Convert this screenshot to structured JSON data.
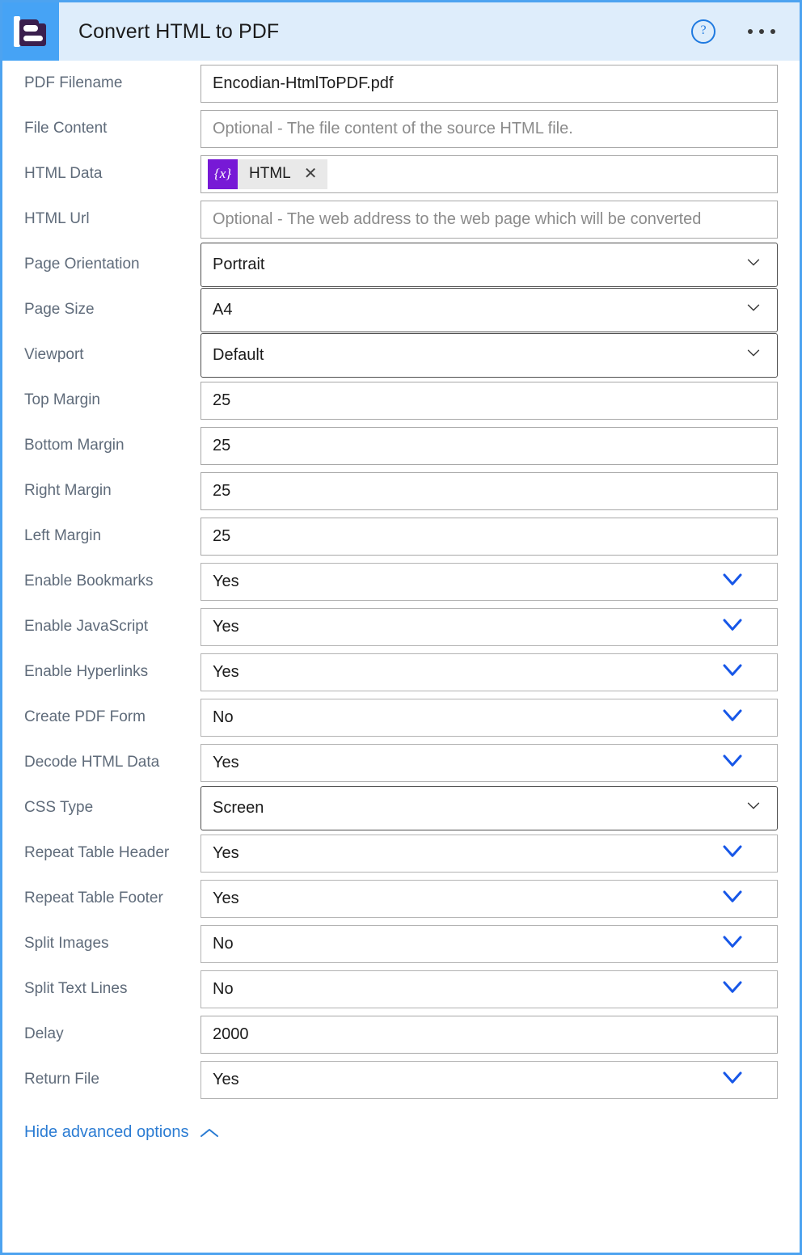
{
  "header": {
    "title": "Convert HTML to PDF",
    "logo_icon": "encodian-e-logo",
    "logo_bg": "#46a3f5",
    "logo_fg": "#3a1f4d",
    "band_bg": "#deedfb",
    "help_icon": "help-question-icon",
    "help_glyph": "?",
    "more_icon": "more-options-ellipsis-icon"
  },
  "theme": {
    "frame_border": "#4da3f0",
    "label_color": "#5f6b7a",
    "link_color": "#2b7cd3",
    "chevron_blue": "#1757e8",
    "chevron_gray": "#3a3a3a",
    "token_badge_bg": "#7719d6",
    "token_bg": "#e9e9e9"
  },
  "fields": [
    {
      "label": "PDF Filename",
      "kind": "text",
      "value": "Encodian-HtmlToPDF.pdf",
      "placeholder": ""
    },
    {
      "label": "File Content",
      "kind": "text",
      "value": "",
      "placeholder": "Optional - The file content of the source HTML file."
    },
    {
      "label": "HTML Data",
      "kind": "token",
      "token_badge": "{x}",
      "token_label": "HTML",
      "token_close": "✕"
    },
    {
      "label": "HTML Url",
      "kind": "text",
      "value": "",
      "placeholder": "Optional - The web address to the web page which will be converted"
    },
    {
      "label": "Page Orientation",
      "kind": "combo",
      "value": "Portrait"
    },
    {
      "label": "Page Size",
      "kind": "combo",
      "value": "A4"
    },
    {
      "label": "Viewport",
      "kind": "combo",
      "value": "Default"
    },
    {
      "label": "Top Margin",
      "kind": "text",
      "value": "25",
      "placeholder": ""
    },
    {
      "label": "Bottom Margin",
      "kind": "text",
      "value": "25",
      "placeholder": ""
    },
    {
      "label": "Right Margin",
      "kind": "text",
      "value": "25",
      "placeholder": ""
    },
    {
      "label": "Left Margin",
      "kind": "text",
      "value": "25",
      "placeholder": ""
    },
    {
      "label": "Enable Bookmarks",
      "kind": "dropdown",
      "value": "Yes"
    },
    {
      "label": "Enable JavaScript",
      "kind": "dropdown",
      "value": "Yes"
    },
    {
      "label": "Enable Hyperlinks",
      "kind": "dropdown",
      "value": "Yes"
    },
    {
      "label": "Create PDF Form",
      "kind": "dropdown",
      "value": "No"
    },
    {
      "label": "Decode HTML Data",
      "kind": "dropdown",
      "value": "Yes"
    },
    {
      "label": "CSS Type",
      "kind": "combo",
      "value": "Screen"
    },
    {
      "label": "Repeat Table Header",
      "kind": "dropdown",
      "value": "Yes"
    },
    {
      "label": "Repeat Table Footer",
      "kind": "dropdown",
      "value": "Yes"
    },
    {
      "label": "Split Images",
      "kind": "dropdown",
      "value": "No"
    },
    {
      "label": "Split Text Lines",
      "kind": "dropdown",
      "value": "No"
    },
    {
      "label": "Delay",
      "kind": "text",
      "value": "2000",
      "placeholder": ""
    },
    {
      "label": "Return File",
      "kind": "dropdown",
      "value": "Yes"
    }
  ],
  "footer": {
    "advanced_link": "Hide advanced options",
    "advanced_icon": "chevron-up-icon"
  }
}
